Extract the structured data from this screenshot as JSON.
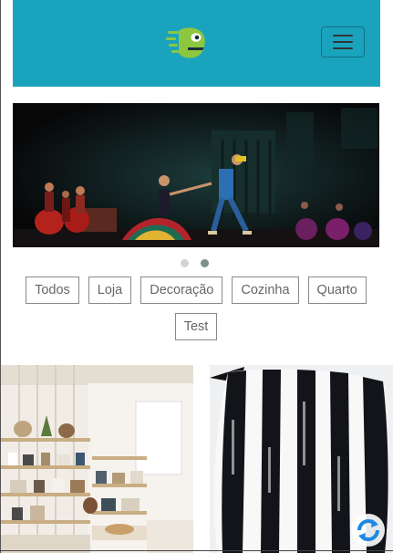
{
  "header": {
    "logo_icon": "green-fish-logo",
    "menu_icon": "hamburger-menu-icon",
    "background_color": "#1aa3bd"
  },
  "carousel": {
    "slide_count": 2,
    "active_slide": 2
  },
  "filters": [
    "Todos",
    "Loja",
    "Decoração",
    "Cozinha",
    "Quarto",
    "Test"
  ],
  "products": [
    {
      "image": "shop-interior-shelves"
    },
    {
      "image": "striped-pillow"
    }
  ],
  "floating": {
    "icon": "refresh-icon",
    "color": "#1e88e5"
  }
}
